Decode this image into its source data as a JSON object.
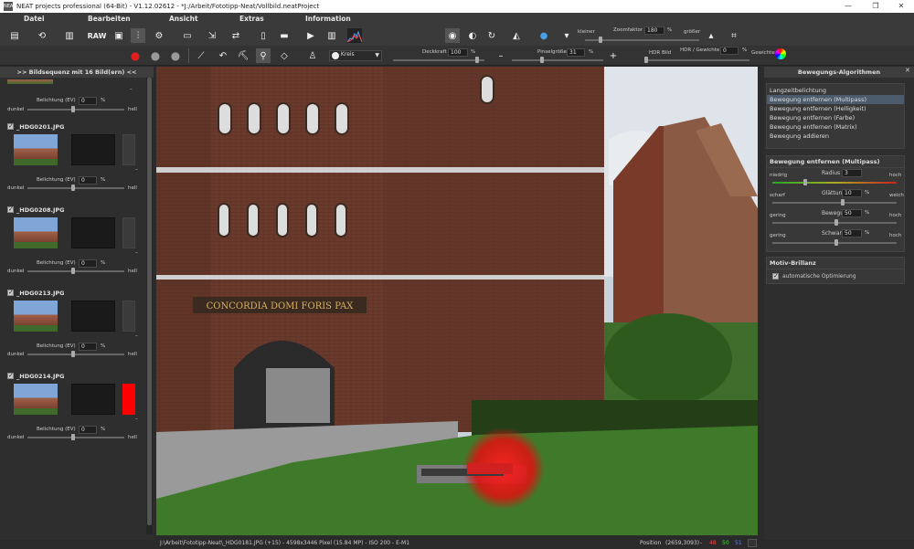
{
  "window": {
    "title": "NEAT projects professional (64-Bit) - V1.12.02612 - *J:/Arbeit/Fototipp-Neat/Vollbild.neatProject",
    "app_icon": "NEAT"
  },
  "menu": [
    "Datei",
    "Bearbeiten",
    "Ansicht",
    "Extras",
    "Information"
  ],
  "toolbar": {
    "raw_label": "RAW",
    "kleiner": "kleiner",
    "zoom_label": "Zoomfaktor",
    "zoom_value": "180",
    "zoom_unit": "%",
    "groesser": "größer",
    "deckkraft_label": "Deckkraft",
    "deckkraft_value": "100",
    "pinsel_label": "Pinselgröße",
    "pinsel_value": "31",
    "percent": "%",
    "hdr_bild": "HDR Bild",
    "hdr_gewichte": "HDR / Gewichte",
    "hdr_value": "0",
    "gewichte": "Gewichte",
    "brush_shape": "Kreis",
    "minus": "–",
    "plus": "+"
  },
  "left_panel": {
    "header": ">> Bildsequenz mit 16 Bild(ern) <<",
    "dunkel": "dunkel",
    "hell": "hell",
    "belichtung": "Belichtung (EV)",
    "belichtung_value": "0",
    "percent": "%",
    "dash": "–",
    "items": [
      {
        "name": "_HDG0201.JPG"
      },
      {
        "name": "_HDG0208.JPG"
      },
      {
        "name": "_HDG0213.JPG"
      },
      {
        "name": "_HDG0214.JPG"
      }
    ]
  },
  "canvas": {
    "inscription": "CONCORDIA DOMI FORIS PAX"
  },
  "right_panel": {
    "header": "Bewegungs-Algorithmen",
    "algorithms": [
      "Langzeitbelichtung",
      "Bewegung entfernen (Multipass)",
      "Bewegung entfernen (Helligkeit)",
      "Bewegung entfernen (Farbe)",
      "Bewegung entfernen (Matrix)",
      "Bewegung addieren"
    ],
    "selected": 1,
    "settings_title": "Bewegung entfernen (Multipass)",
    "settings": [
      {
        "left": "niedrig",
        "label": "Radius",
        "value": "3",
        "unit": "",
        "right": "hoch",
        "level": 0.25
      },
      {
        "left": "scharf",
        "label": "Glättung",
        "value": "10",
        "unit": "%",
        "right": "weich",
        "level": 0.55
      },
      {
        "left": "gering",
        "label": "Bewegung",
        "value": "50",
        "unit": "%",
        "right": "hoch",
        "level": 0.5
      },
      {
        "left": "gering",
        "label": "Schwankung",
        "value": "50",
        "unit": "%",
        "right": "hoch",
        "level": 0.5
      }
    ],
    "brillanz_title": "Motiv-Brillanz",
    "auto_opt": "automatische Optimierung"
  },
  "status": {
    "text": "J:\\Arbeit\\Fototipp-Neat\\_HDG0181.JPG (+15) - 4598x3446 Pixel (15.84 MP) - ISO 200 - E-M1",
    "position": "Position",
    "coords": "(2659,3093)",
    "dash": "-",
    "r": "48",
    "g": "50",
    "b": "51"
  },
  "colors": {
    "accent_red": "#e01010",
    "select": "#4d5c6c"
  }
}
